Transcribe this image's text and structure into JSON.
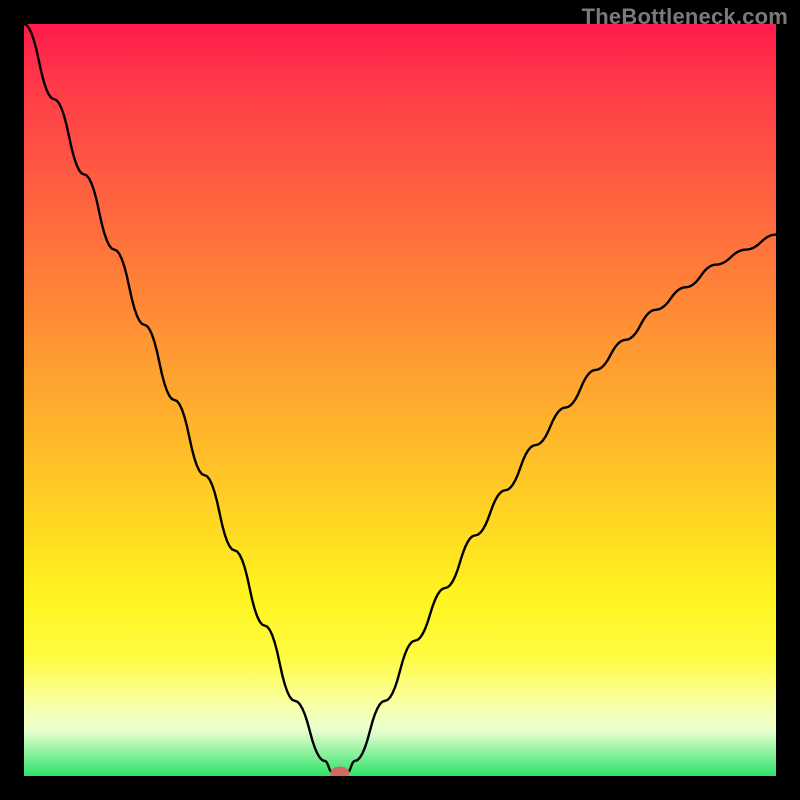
{
  "watermark": "TheBottleneck.com",
  "chart_data": {
    "type": "line",
    "title": "",
    "xlabel": "",
    "ylabel": "",
    "xlim": [
      0,
      100
    ],
    "ylim": [
      0,
      100
    ],
    "grid": false,
    "legend": false,
    "gradient_stops": [
      {
        "pos": 0,
        "color": "#ff1a4b"
      },
      {
        "pos": 20,
        "color": "#ff5a42"
      },
      {
        "pos": 44,
        "color": "#ff9a32"
      },
      {
        "pos": 66,
        "color": "#ffd622"
      },
      {
        "pos": 84,
        "color": "#fffc40"
      },
      {
        "pos": 94,
        "color": "#e8ffd0"
      },
      {
        "pos": 100,
        "color": "#2de36a"
      }
    ],
    "series": [
      {
        "name": "bottleneck-curve",
        "x": [
          0,
          4,
          8,
          12,
          16,
          20,
          24,
          28,
          32,
          36,
          40,
          41,
          42,
          43,
          44,
          48,
          52,
          56,
          60,
          64,
          68,
          72,
          76,
          80,
          84,
          88,
          92,
          96,
          100
        ],
        "y": [
          100,
          90,
          80,
          70,
          60,
          50,
          40,
          30,
          20,
          10,
          2,
          0.5,
          0,
          0.5,
          2,
          10,
          18,
          25,
          32,
          38,
          44,
          49,
          54,
          58,
          62,
          65,
          68,
          70,
          72
        ]
      }
    ],
    "minimum_marker": {
      "x": 42,
      "y": 0
    }
  }
}
